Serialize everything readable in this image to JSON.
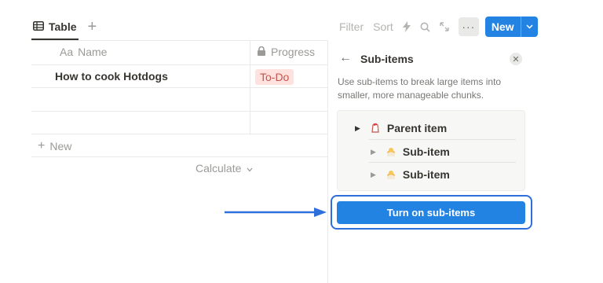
{
  "view": {
    "tab_label": "Table",
    "add_tab_symbol": "+"
  },
  "toolbar": {
    "filter_label": "Filter",
    "sort_label": "Sort",
    "more_symbol": "···",
    "new_label": "New"
  },
  "table": {
    "columns": [
      {
        "label": "Name",
        "type_prefix": "Aa"
      },
      {
        "label": "Progress"
      }
    ],
    "rows": [
      {
        "name": "How to cook Hotdogs",
        "progress": "To-Do"
      }
    ],
    "new_row_label": "New",
    "new_row_symbol": "+",
    "calculate_label": "Calculate"
  },
  "side_panel": {
    "title": "Sub-items",
    "description": "Use sub-items to break large items into smaller, more manageable chunks.",
    "preview": {
      "parent_label": "Parent item",
      "children": [
        "Sub-item",
        "Sub-item"
      ]
    },
    "action_button_label": "Turn on sub-items"
  },
  "colors": {
    "accent": "#2383e2",
    "annotation": "#2f6fdb",
    "tag_bg": "#ffe2dd",
    "tag_text": "#c4554d"
  },
  "icons": [
    "table-icon",
    "lightning-icon",
    "search-icon",
    "expand-icon",
    "lock-icon",
    "back-arrow-icon",
    "close-icon",
    "chicken-emoji-icon",
    "chick-emoji-icon"
  ]
}
